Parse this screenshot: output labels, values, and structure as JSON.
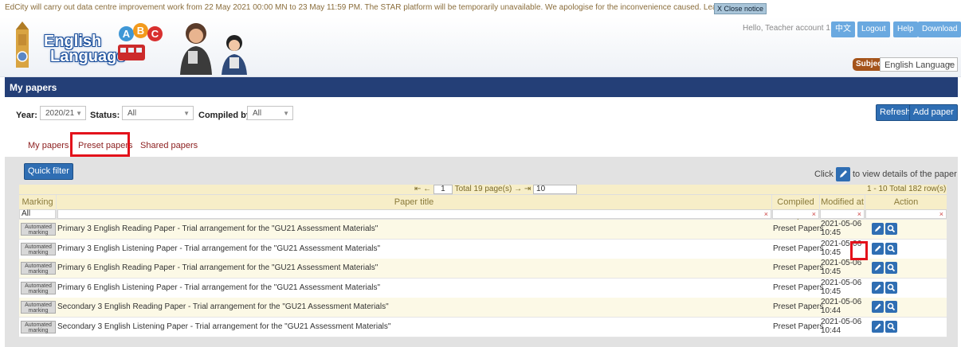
{
  "notice": {
    "text": "EdCity will carry out data centre improvement work from 22 May 2021 00:00 MN to 23 May 11:59 PM. The STAR platform will be temporarily unavailable.  We apologise for the inconvenience caused. Learn more",
    "close_label": "X Close notice"
  },
  "header": {
    "logo_line1": "English",
    "logo_line2": "Language",
    "abc": [
      "A",
      "B",
      "C"
    ],
    "hello": "Hello, Teacher account 1",
    "buttons": [
      "中文",
      "Logout",
      "Help",
      "Download"
    ],
    "subject_label": "Subject",
    "subject_value": "English Language"
  },
  "section_title": "My papers",
  "filters": {
    "year_label": "Year:",
    "year_value": "2020/21",
    "status_label": "Status:",
    "status_value": "All",
    "compiled_label": "Compiled by:",
    "compiled_value": "All",
    "refresh": "Refresh",
    "add_paper": "Add paper"
  },
  "tabs": [
    "My papers",
    "Preset papers",
    "Shared papers"
  ],
  "quick_filter": "Quick filter",
  "hint_prefix": "Click",
  "hint_suffix": "to view details of the paper",
  "pager": {
    "page": "1",
    "total": "Total 19 page(s)",
    "size": "10",
    "rowcount": "1 - 10 Total 182 row(s)"
  },
  "columns": {
    "marking": "Marking",
    "title": "Paper title",
    "compiled": "Compiled by",
    "modified": "Modified at",
    "action": "Action",
    "marking_filter": "All"
  },
  "rows": [
    {
      "badge": "Automated marking",
      "title": "Primary 3 English Reading Paper - Trial arrangement for the \"GU21 Assessment Materials\"",
      "compiled": "Preset Papers",
      "date": "2021-05-06",
      "time": "10:45"
    },
    {
      "badge": "Automated marking",
      "title": "Primary 3 English Listening Paper - Trial arrangement for the \"GU21 Assessment Materials\"",
      "compiled": "Preset Papers",
      "date": "2021-05-06",
      "time": "10:45"
    },
    {
      "badge": "Automated marking",
      "title": "Primary 6 English Reading Paper - Trial arrangement for the \"GU21 Assessment Materials\"",
      "compiled": "Preset Papers",
      "date": "2021-05-06",
      "time": "10:45"
    },
    {
      "badge": "Automated marking",
      "title": "Primary 6 English Listening Paper - Trial arrangement for the \"GU21 Assessment Materials\"",
      "compiled": "Preset Papers",
      "date": "2021-05-06",
      "time": "10:45"
    },
    {
      "badge": "Automated marking",
      "title": "Secondary 3 English Reading Paper - Trial arrangement for the \"GU21 Assessment Materials\"",
      "compiled": "Preset Papers",
      "date": "2021-05-06",
      "time": "10:44"
    },
    {
      "badge": "Automated marking",
      "title": "Secondary 3 English Listening Paper - Trial arrangement for the \"GU21 Assessment Materials\"",
      "compiled": "Preset Papers",
      "date": "2021-05-06",
      "time": "10:44"
    }
  ],
  "colors": {
    "nav_bar": "#243f77",
    "button_blue": "#2f6eb3",
    "highlight_red": "#e3121b",
    "subject_brown": "#a5541b"
  }
}
